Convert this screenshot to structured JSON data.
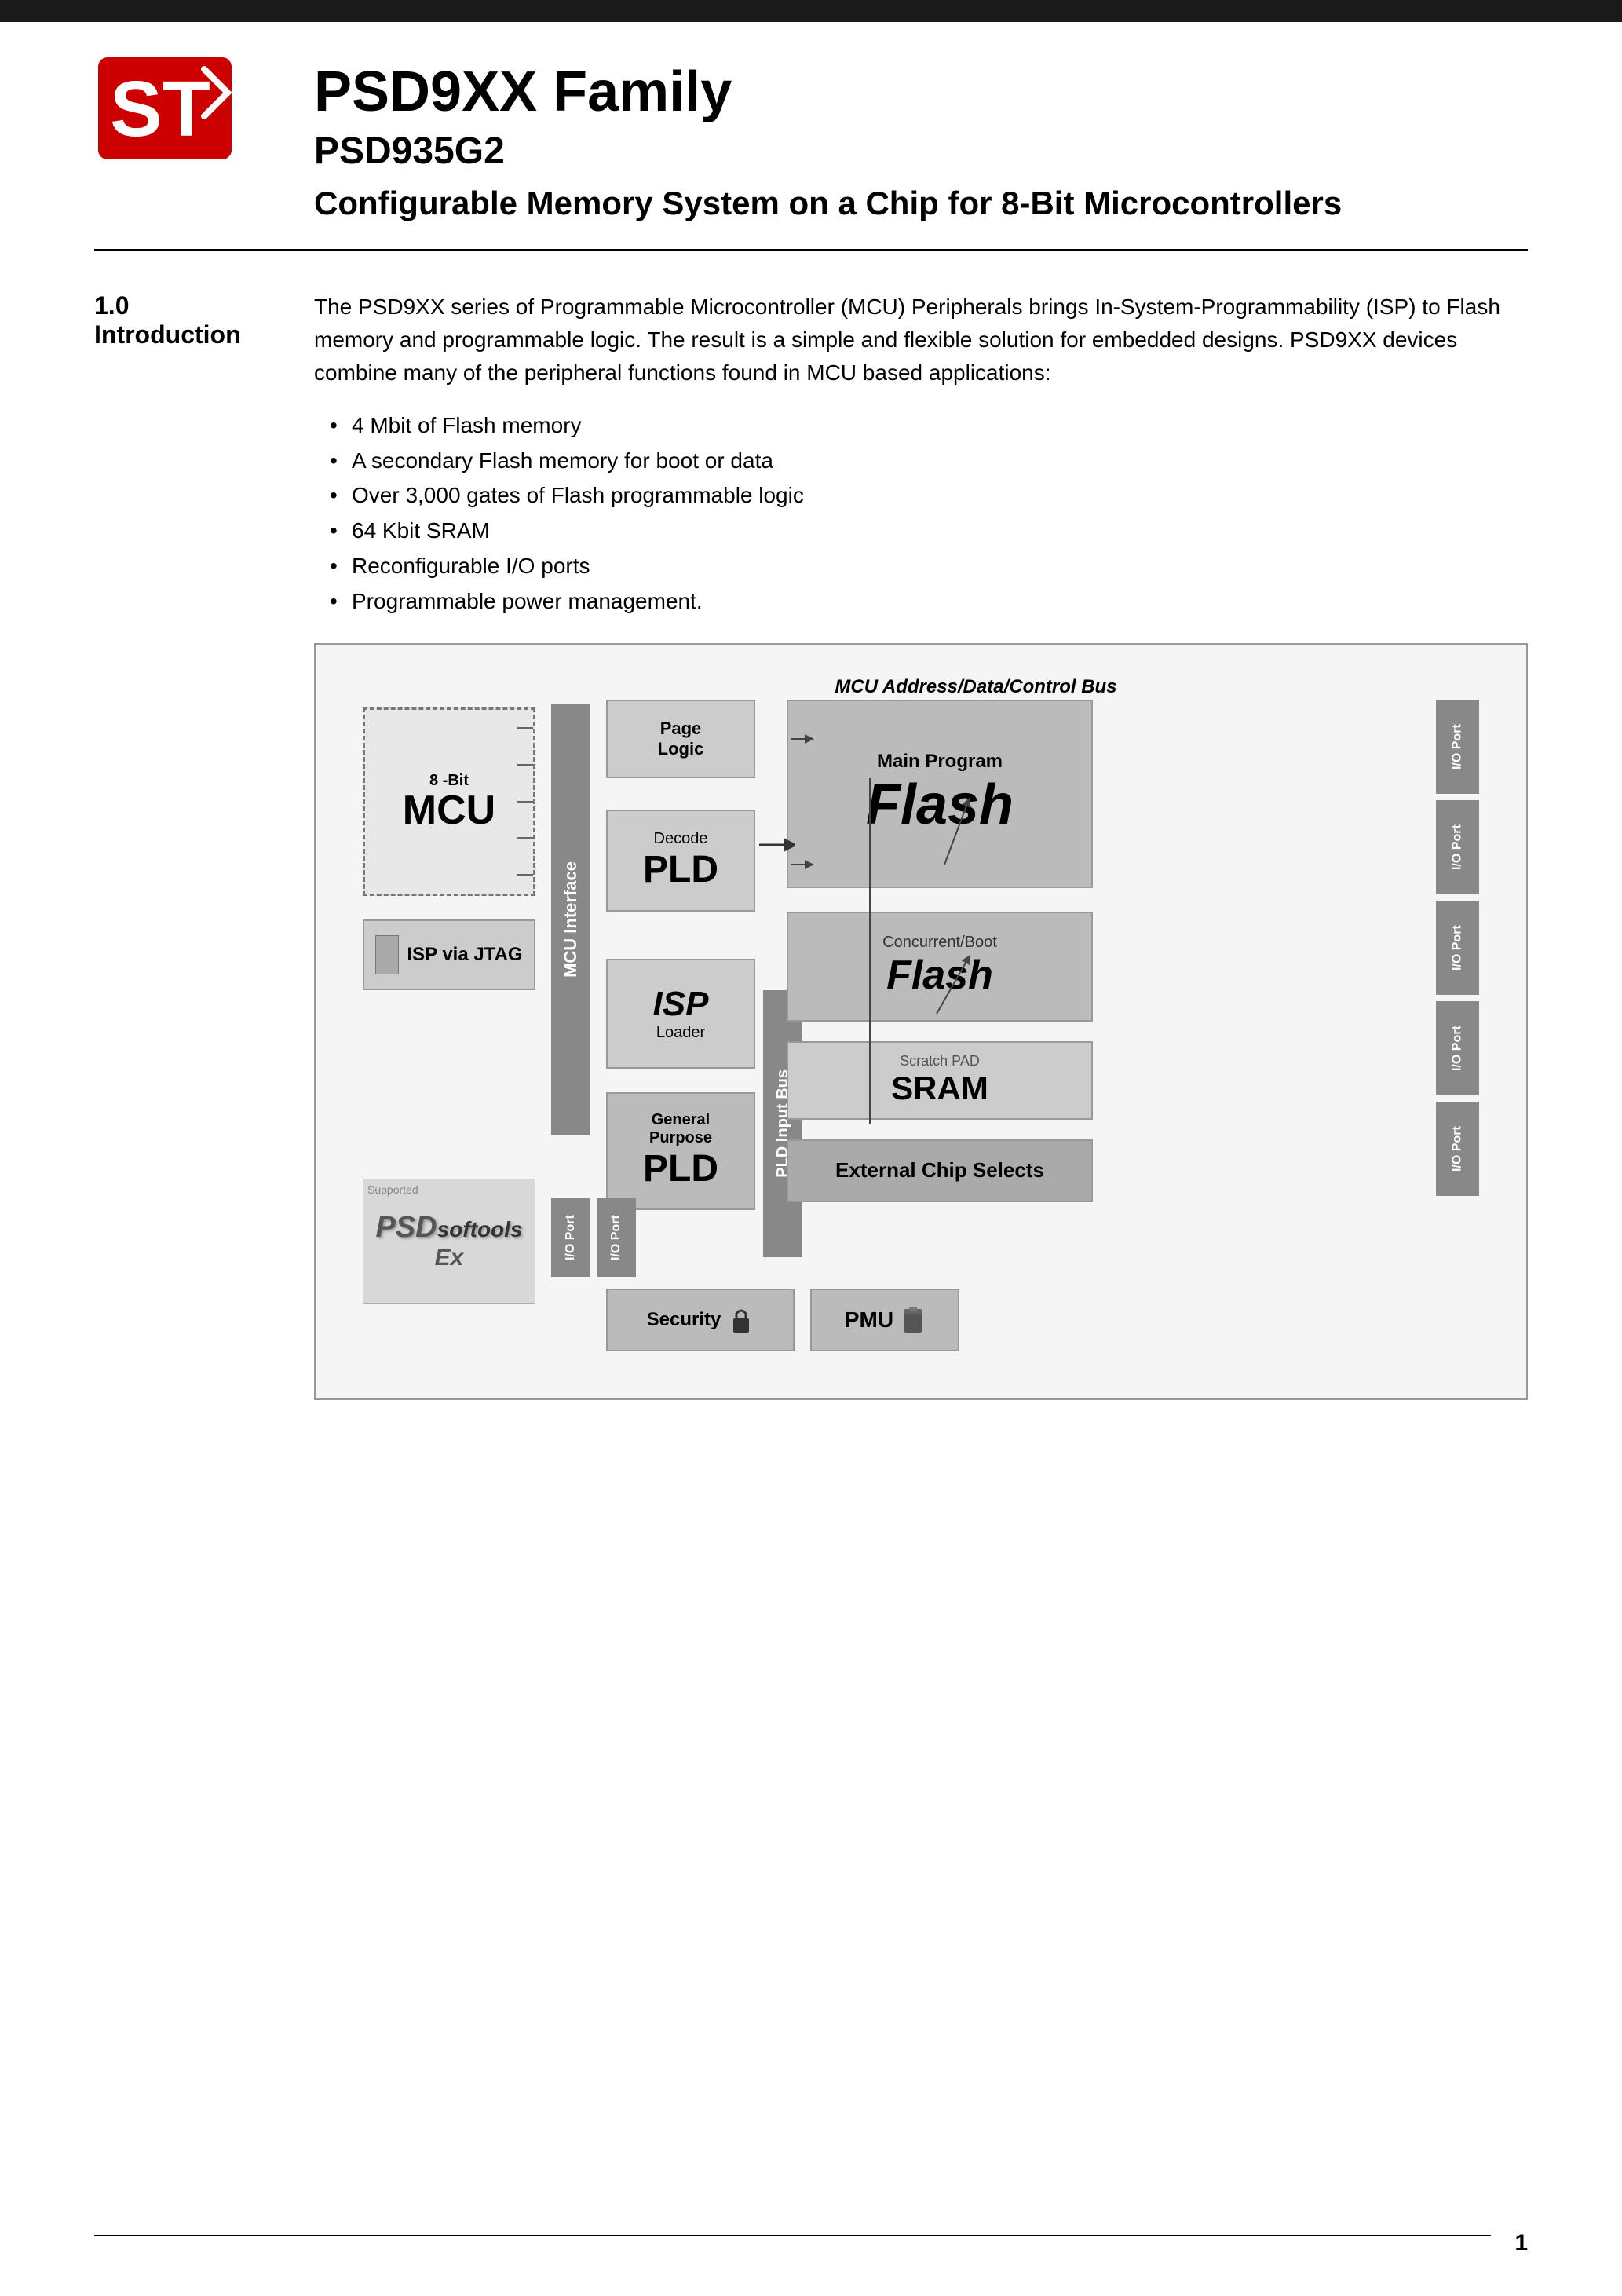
{
  "header": {
    "bar_color": "#1a1a1a",
    "logo_alt": "ST Microelectronics Logo",
    "main_title": "PSD9XX Family",
    "sub_title": "PSD935G2",
    "desc_title": "Configurable Memory System on a Chip for 8-Bit Microcontrollers"
  },
  "section": {
    "number": "1.0",
    "name": "Introduction",
    "intro_paragraph": "The PSD9XX series of Programmable Microcontroller (MCU) Peripherals brings In-System-Programmability (ISP) to Flash memory and programmable logic. The result is a simple and flexible solution for embedded designs. PSD9XX devices combine many of the peripheral functions found in MCU based applications:",
    "bullets": [
      "4 Mbit of Flash memory",
      "A secondary Flash memory for boot or data",
      "Over 3,000 gates of Flash programmable logic",
      "64 Kbit SRAM",
      "Reconfigurable I/O ports",
      "Programmable power management."
    ]
  },
  "diagram": {
    "bus_label": "MCU Address/Data/Control Bus",
    "mcu_label_small": "8 -Bit",
    "mcu_label_large": "MCU",
    "mcu_interface": "MCU Interface",
    "pld_input_bus": "PLD Input Bus",
    "page_logic": "Page\nLogic",
    "decode": "Decode",
    "pld": "PLD",
    "isp_label": "ISP",
    "isp_loader": "Loader",
    "general_purpose": "General\nPurpose",
    "main_program": "Main Program",
    "flash_main": "Flash",
    "concurrent_boot": "Concurrent/Boot",
    "flash_boot": "Flash",
    "scratch_pad": "Scratch PAD",
    "sram": "SRAM",
    "external_chip_selects": "External Chip Selects",
    "security": "Security",
    "pmu": "PMU",
    "isp_jtag": "ISP via JTAG",
    "io_port": "I/O Port",
    "supported_text": "Supported"
  },
  "footer": {
    "page_number": "1"
  }
}
